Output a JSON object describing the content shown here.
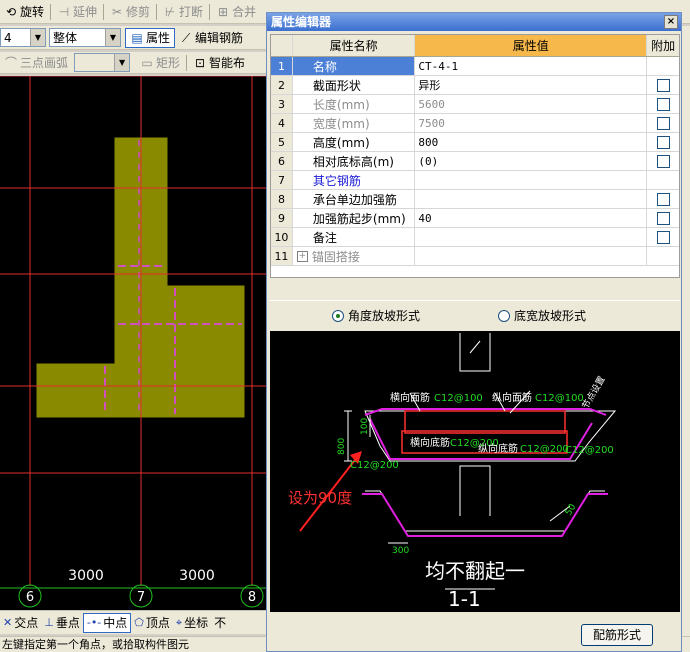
{
  "toolbar1": {
    "items": [
      {
        "label": "旋转",
        "icon": "rotate-icon",
        "enabled": true
      },
      {
        "label": "延伸",
        "icon": "extend-icon",
        "enabled": false
      },
      {
        "label": "修剪",
        "icon": "trim-icon",
        "enabled": false
      },
      {
        "label": "打断",
        "icon": "break-icon",
        "enabled": false
      },
      {
        "label": "合并",
        "icon": "merge-icon",
        "enabled": false
      }
    ]
  },
  "toolbar2": {
    "floor_value": "4",
    "component_value": "整体",
    "property_label": "属性",
    "edit_rebar_label": "编辑钢筋"
  },
  "toolbar3": {
    "arc_label": "三点画弧",
    "rect_label": "矩形",
    "smart_label": "智能布"
  },
  "cad": {
    "dims": [
      "3000",
      "3000"
    ],
    "axes": [
      "6",
      "7",
      "8"
    ]
  },
  "snapbar": {
    "items": [
      {
        "label": "交点",
        "icon": "intersection-icon",
        "on": false
      },
      {
        "label": "垂点",
        "icon": "perpendicular-icon",
        "on": false
      },
      {
        "label": "中点",
        "icon": "midpoint-icon",
        "on": true
      },
      {
        "label": "顶点",
        "icon": "vertex-icon",
        "on": false
      },
      {
        "label": "坐标",
        "icon": "coordinate-icon",
        "on": false
      },
      {
        "label": "不",
        "icon": "",
        "on": false
      }
    ]
  },
  "status_text": "左键指定第一个角点，或拾取构件图元",
  "dialog": {
    "title": "属性编辑器",
    "close": "×",
    "headers": {
      "name": "属性名称",
      "value": "属性值",
      "extra": "附加"
    },
    "rows": [
      {
        "no": "1",
        "name": "名称",
        "value": "CT-4-1",
        "check": false,
        "style": "sel"
      },
      {
        "no": "2",
        "name": "截面形状",
        "value": "异形",
        "check": true,
        "style": ""
      },
      {
        "no": "3",
        "name": "长度(mm)",
        "value": "5600",
        "check": true,
        "style": "grey"
      },
      {
        "no": "4",
        "name": "宽度(mm)",
        "value": "7500",
        "check": true,
        "style": "grey"
      },
      {
        "no": "5",
        "name": "高度(mm)",
        "value": "800",
        "check": true,
        "style": ""
      },
      {
        "no": "6",
        "name": "相对底标高(m)",
        "value": "(0)",
        "check": true,
        "style": ""
      },
      {
        "no": "7",
        "name": "其它钢筋",
        "value": "",
        "check": false,
        "style": "blue"
      },
      {
        "no": "8",
        "name": "承台单边加强筋",
        "value": "",
        "check": true,
        "style": ""
      },
      {
        "no": "9",
        "name": "加强筋起步(mm)",
        "value": "40",
        "check": true,
        "style": ""
      },
      {
        "no": "10",
        "name": "备注",
        "value": "",
        "check": true,
        "style": ""
      },
      {
        "no": "11",
        "name": "锚固搭接",
        "value": "",
        "check": false,
        "style": "grey-plus"
      }
    ],
    "radio_angle": "角度放坡形式",
    "radio_width": "底宽放坡形式",
    "config_button": "配筋形式"
  },
  "preview": {
    "label_horiz_top": "横向面筋",
    "label_horiz_top_spec": "C12@100",
    "label_long_top": "纵向面筋",
    "label_long_top_spec": "C12@100",
    "label_horiz_bot": "横向底筋",
    "label_horiz_bot_spec": "C12@200",
    "label_long_bot": "纵向底筋",
    "label_long_bot_spec": "C12@200",
    "label_left_spec": "C12@200",
    "label_right_spec": "C12@200",
    "label_side": "节点设置",
    "dim_800": "800",
    "dim_100": "100",
    "dim_300": "300",
    "dim_50": "50",
    "annotation": "设为90度",
    "caption": "均不翻起一",
    "section": "1-1"
  }
}
